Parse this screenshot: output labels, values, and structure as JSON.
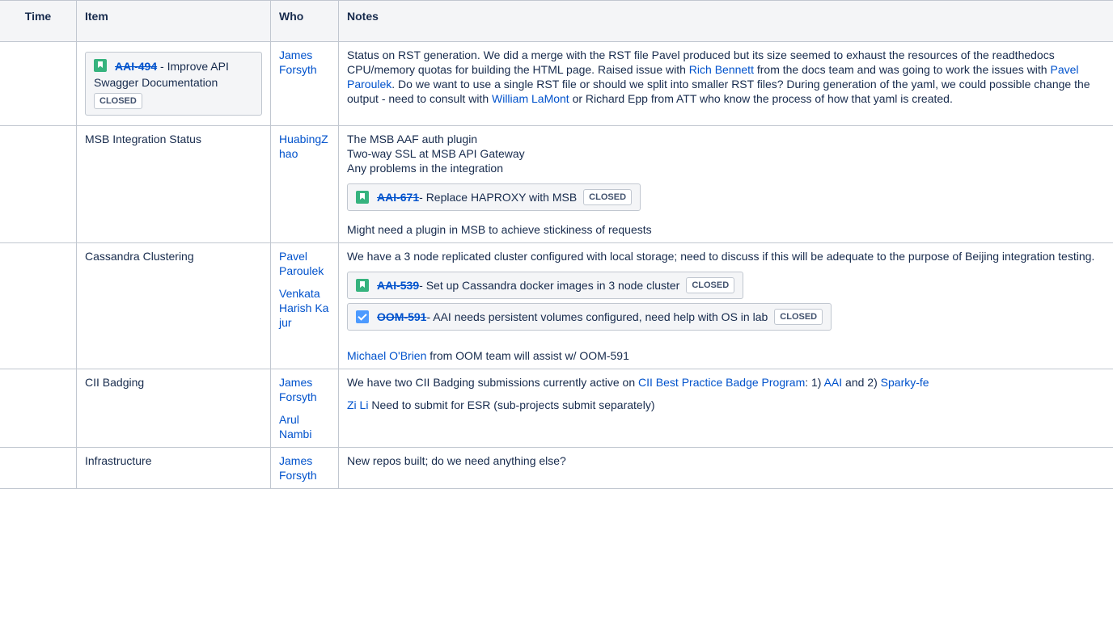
{
  "headers": {
    "time": "Time",
    "item": "Item",
    "who": "Who",
    "notes": "Notes"
  },
  "colors": {
    "link": "#0052cc",
    "story_icon": "#36b37e",
    "task_icon": "#4c9aff",
    "header_bg": "#f4f5f7",
    "border": "#c1c7d0"
  },
  "rows": [
    {
      "time": "",
      "item": {
        "jira": {
          "icon": "story-bookmark-icon",
          "key": "AAI-494",
          "title": " - Improve API Swagger Documentation",
          "status": "CLOSED"
        }
      },
      "who": [
        "James Forsyth"
      ],
      "notes": {
        "p1": "Status on RST generation. We did a merge with the RST file Pavel produced but its size seemed to exhaust the resources of the readthedocs CPU/memory quotas for building the HTML page. Raised issue with ",
        "l1": "Rich Bennett",
        "p2": " from the docs team and was going to work the issues with ",
        "l2": "Pavel Paroulek",
        "p3": ". Do we want to use a single RST file or should we split into smaller RST files? During generation of the yaml, we could possible change the output - need to consult with ",
        "l3": "William LaMont",
        "p4": " or Richard Epp from ATT who know the process of how that yaml is created."
      }
    },
    {
      "time": "",
      "item": "MSB Integration Status",
      "who": [
        "HuabingZhao"
      ],
      "notes": {
        "lines": [
          "The MSB AAF auth plugin",
          "Two-way SSL at MSB API Gateway",
          "Any problems in the integration"
        ],
        "jira": {
          "icon": "story-bookmark-icon",
          "key": "AAI-671",
          "title": " - Replace HAPROXY with MSB",
          "status": "CLOSED"
        },
        "after": "Might need a plugin in MSB to achieve stickiness of requests"
      }
    },
    {
      "time": "",
      "item": "Cassandra Clustering",
      "who": [
        "Pavel Paroulek",
        "Venkata Harish Kajur"
      ],
      "notes": {
        "p1": "We have a 3 node replicated cluster configured with local storage; need to discuss if this will be adequate to the purpose of Beijing integration testing.",
        "jira1": {
          "icon": "story-bookmark-icon",
          "key": "AAI-539",
          "title": " - Set up Cassandra docker images in 3 node cluster",
          "status": "CLOSED"
        },
        "jira2": {
          "icon": "task-checkbox-icon",
          "key": "OOM-591",
          "title": " - AAI needs persistent volumes configured, need help with OS in lab",
          "status": "CLOSED"
        },
        "link": "Michael O'Brien",
        "after": " from OOM team will assist w/ OOM-591"
      }
    },
    {
      "time": "",
      "item": "CII Badging",
      "who": [
        "James Forsyth",
        "Arul Nambi"
      ],
      "notes": {
        "p1": "We have two CII Badging submissions currently active on ",
        "l1": "CII Best Practice Badge Program",
        "p2": ": 1) ",
        "l2": "AAI",
        "p3": " and 2) ",
        "l3": "Sparky-fe",
        "l4": "Zi Li",
        "p4": " Need to submit for ESR (sub-projects submit separately)"
      }
    },
    {
      "time": "",
      "item": "Infrastructure",
      "who": [
        "James Forsyth"
      ],
      "notes": {
        "p1": "New repos built; do we need anything else?"
      }
    }
  ]
}
